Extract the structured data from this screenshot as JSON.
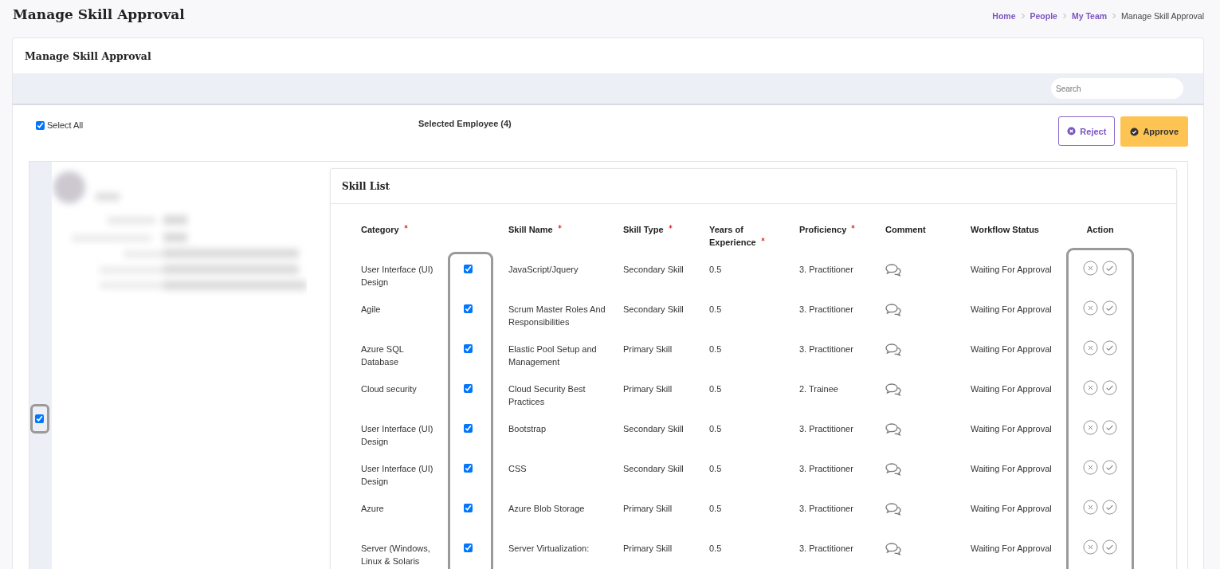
{
  "page_title": "Manage Skill Approval",
  "breadcrumb": [
    {
      "label": "Home",
      "current": false
    },
    {
      "label": "People",
      "current": false
    },
    {
      "label": "My Team",
      "current": false
    },
    {
      "label": "Manage Skill Approval",
      "current": true
    }
  ],
  "card_title": "Manage Skill Approval",
  "search": {
    "placeholder": "Search"
  },
  "select_all": {
    "label": "Select All",
    "checked": true
  },
  "selected_employee": "Selected Employee (4)",
  "buttons": [
    {
      "kind": "reject",
      "label": "Reject"
    },
    {
      "kind": "approve",
      "label": "Approve"
    }
  ],
  "employee": {
    "checked": true
  },
  "skill_list": {
    "title": "Skill List",
    "columns": [
      {
        "label": "Category",
        "required": true
      },
      {
        "label": "Skill Name",
        "required": true
      },
      {
        "label": "Skill Type",
        "required": true
      },
      {
        "label": "Years of Experience",
        "required": true
      },
      {
        "label": "Proficiency",
        "required": true
      },
      {
        "label": "Comment",
        "required": false
      },
      {
        "label": "Workflow Status",
        "required": false
      },
      {
        "label": "Action",
        "required": false
      }
    ],
    "rows": [
      {
        "category": "User Interface (UI) Design",
        "checked": true,
        "skill_name": "JavaScript/Jquery",
        "skill_type": "Secondary Skill",
        "years": "0.5",
        "proficiency": "3. Practitioner",
        "status": "Waiting For Approval"
      },
      {
        "category": "Agile",
        "checked": true,
        "skill_name": "Scrum Master Roles And Responsibilities",
        "skill_type": "Secondary Skill",
        "years": "0.5",
        "proficiency": "3. Practitioner",
        "status": "Waiting For Approval"
      },
      {
        "category": "Azure SQL Database",
        "checked": true,
        "skill_name": "Elastic Pool Setup and Management",
        "skill_type": "Primary Skill",
        "years": "0.5",
        "proficiency": "3. Practitioner",
        "status": "Waiting For Approval"
      },
      {
        "category": "Cloud security",
        "checked": true,
        "skill_name": "Cloud Security Best Practices",
        "skill_type": "Primary Skill",
        "years": "0.5",
        "proficiency": "2. Trainee",
        "status": "Waiting For Approval"
      },
      {
        "category": "User Interface (UI) Design",
        "checked": true,
        "skill_name": "Bootstrap",
        "skill_type": "Secondary Skill",
        "years": "0.5",
        "proficiency": "3. Practitioner",
        "status": "Waiting For Approval"
      },
      {
        "category": "User Interface (UI) Design",
        "checked": true,
        "skill_name": "CSS",
        "skill_type": "Secondary Skill",
        "years": "0.5",
        "proficiency": "3. Practitioner",
        "status": "Waiting For Approval"
      },
      {
        "category": "Azure",
        "checked": true,
        "skill_name": "Azure Blob Storage",
        "skill_type": "Primary Skill",
        "years": "0.5",
        "proficiency": "3. Practitioner",
        "status": "Waiting For Approval"
      },
      {
        "category": "Server (Windows, Linux & Solaris",
        "checked": true,
        "skill_name": "Server Virtualization:",
        "skill_type": "Primary Skill",
        "years": "0.5",
        "proficiency": "3. Practitioner",
        "status": "Waiting For Approval"
      }
    ]
  }
}
